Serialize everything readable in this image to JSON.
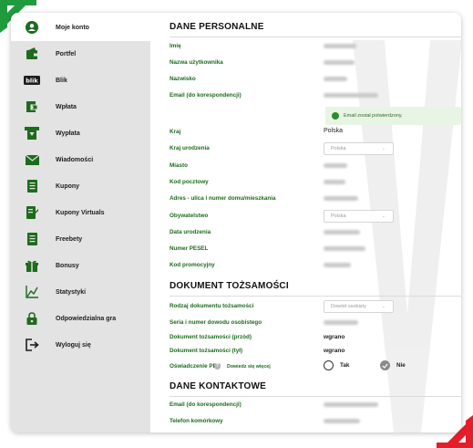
{
  "colors": {
    "accent_green": "#1e6b1e",
    "corner_green": "#1f9b3d",
    "corner_red": "#e41e2b",
    "sidebar_bg": "#e3e3e3",
    "success_bg": "#e9f5e4"
  },
  "sidebar": {
    "items": [
      {
        "label": "Moje konto",
        "icon": "user-circle-icon",
        "active": true
      },
      {
        "label": "Portfel",
        "icon": "wallet-icon"
      },
      {
        "label": "Blik",
        "icon": "blik-icon"
      },
      {
        "label": "Wpłata",
        "icon": "deposit-icon"
      },
      {
        "label": "Wypłata",
        "icon": "withdraw-icon"
      },
      {
        "label": "Wiadomości",
        "icon": "envelope-icon"
      },
      {
        "label": "Kupony",
        "icon": "coupon-icon"
      },
      {
        "label": "Kupony Virtuals",
        "icon": "virtual-coupon-icon"
      },
      {
        "label": "Freebety",
        "icon": "freebet-icon"
      },
      {
        "label": "Bonusy",
        "icon": "gift-icon"
      },
      {
        "label": "Statystyki",
        "icon": "chart-icon"
      },
      {
        "label": "Odpowiedzialna gra",
        "icon": "lock-icon"
      },
      {
        "label": "Wyloguj się",
        "icon": "logout-icon"
      }
    ]
  },
  "personal": {
    "title": "DANE PERSONALNE",
    "fields": {
      "first_name": "Imię",
      "username": "Nazwa użytkownika",
      "last_name": "Nazwisko",
      "email": "Email (do korespondencji)",
      "country": "Kraj",
      "birth_country": "Kraj urodzenia",
      "city": "Miasto",
      "postal_code": "Kod pocztowy",
      "address": "Adres - ulica i numer domu/mieszkania",
      "citizenship": "Obywatelstwo",
      "birth_date": "Data urodzenia",
      "pesel": "Numer PESEL",
      "promo_code": "Kod promocyjny"
    },
    "email_confirmed": "Email został potwierdzony.",
    "country_value": "Polska",
    "birth_country_value": "Polska",
    "citizenship_value": "Polska"
  },
  "identity": {
    "title": "DOKUMENT TOŻSAMOŚCI",
    "fields": {
      "doc_type": "Rodzaj dokumentu tożsamości",
      "doc_number": "Seria i numer dowodu osobistego",
      "front": "Dokument tożsamości (przód)",
      "back": "Dokument tożsamości (tył)",
      "pep": "Oświadczenie PEP"
    },
    "doc_type_value": "Dowód osobisty",
    "front_value": "wgrano",
    "back_value": "wgrano",
    "pep_info": "?",
    "pep_link": "Dowiedz się więcej",
    "pep_yes": "Tak",
    "pep_no": "Nie",
    "pep_selected": "Nie"
  },
  "contact": {
    "title": "DANE KONTAKTOWE",
    "fields": {
      "email": "Email (do korespondencji)",
      "phone": "Telefon komórkowy"
    }
  }
}
